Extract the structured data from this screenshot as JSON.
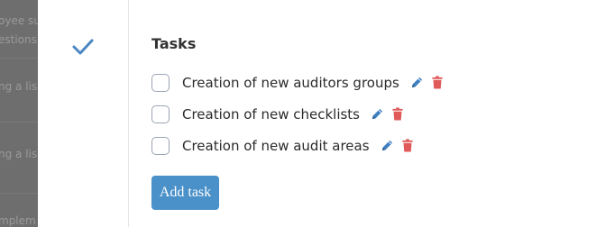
{
  "background_page": {
    "lines": [
      "oyee su",
      "estions",
      "ng a lis",
      "ng a lis",
      "mplem"
    ]
  },
  "tasks": {
    "title": "Tasks",
    "items": [
      {
        "label": "Creation of new auditors groups",
        "checked": false
      },
      {
        "label": "Creation of new checklists",
        "checked": false
      },
      {
        "label": "Creation of new audit areas",
        "checked": false
      }
    ]
  },
  "actions": {
    "add_task_label": "Add task"
  },
  "colors": {
    "accent": "#4a90c9",
    "check": "#4a86c2",
    "edit_icon": "#3f7fc0",
    "delete_icon": "#e05a5a"
  },
  "icons": {
    "completed": "checkmark-icon",
    "edit": "pencil-icon",
    "delete": "trash-icon"
  }
}
